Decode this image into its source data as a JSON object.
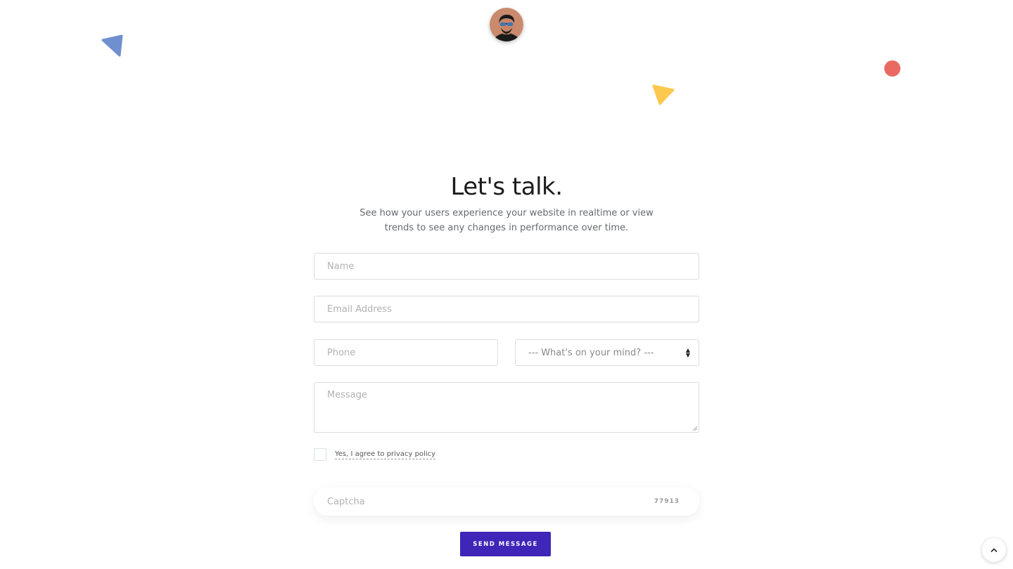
{
  "decorations": {
    "triangle_blue_color": "#6f8fcf",
    "triangle_yellow_color": "#fcc94f",
    "dot_red_color": "#ea6a62"
  },
  "header": {
    "avatar_icon": "user-avatar"
  },
  "hero": {
    "title": "Let's talk.",
    "subtitle": "See how your users experience your website in realtime or view trends to see any changes in performance over time."
  },
  "form": {
    "name_placeholder": "Name",
    "email_placeholder": "Email Address",
    "phone_placeholder": "Phone",
    "topic_select_value": "--- What's on your mind? ---",
    "message_placeholder": "Message",
    "agree_label": "Yes, I agree to privacy policy",
    "captcha_placeholder": "Captcha",
    "captcha_code": "77913",
    "submit_label": "SEND MESSAGE"
  },
  "scroll_top_icon": "chevron-up-icon",
  "colors": {
    "accent": "#3f25b8"
  }
}
